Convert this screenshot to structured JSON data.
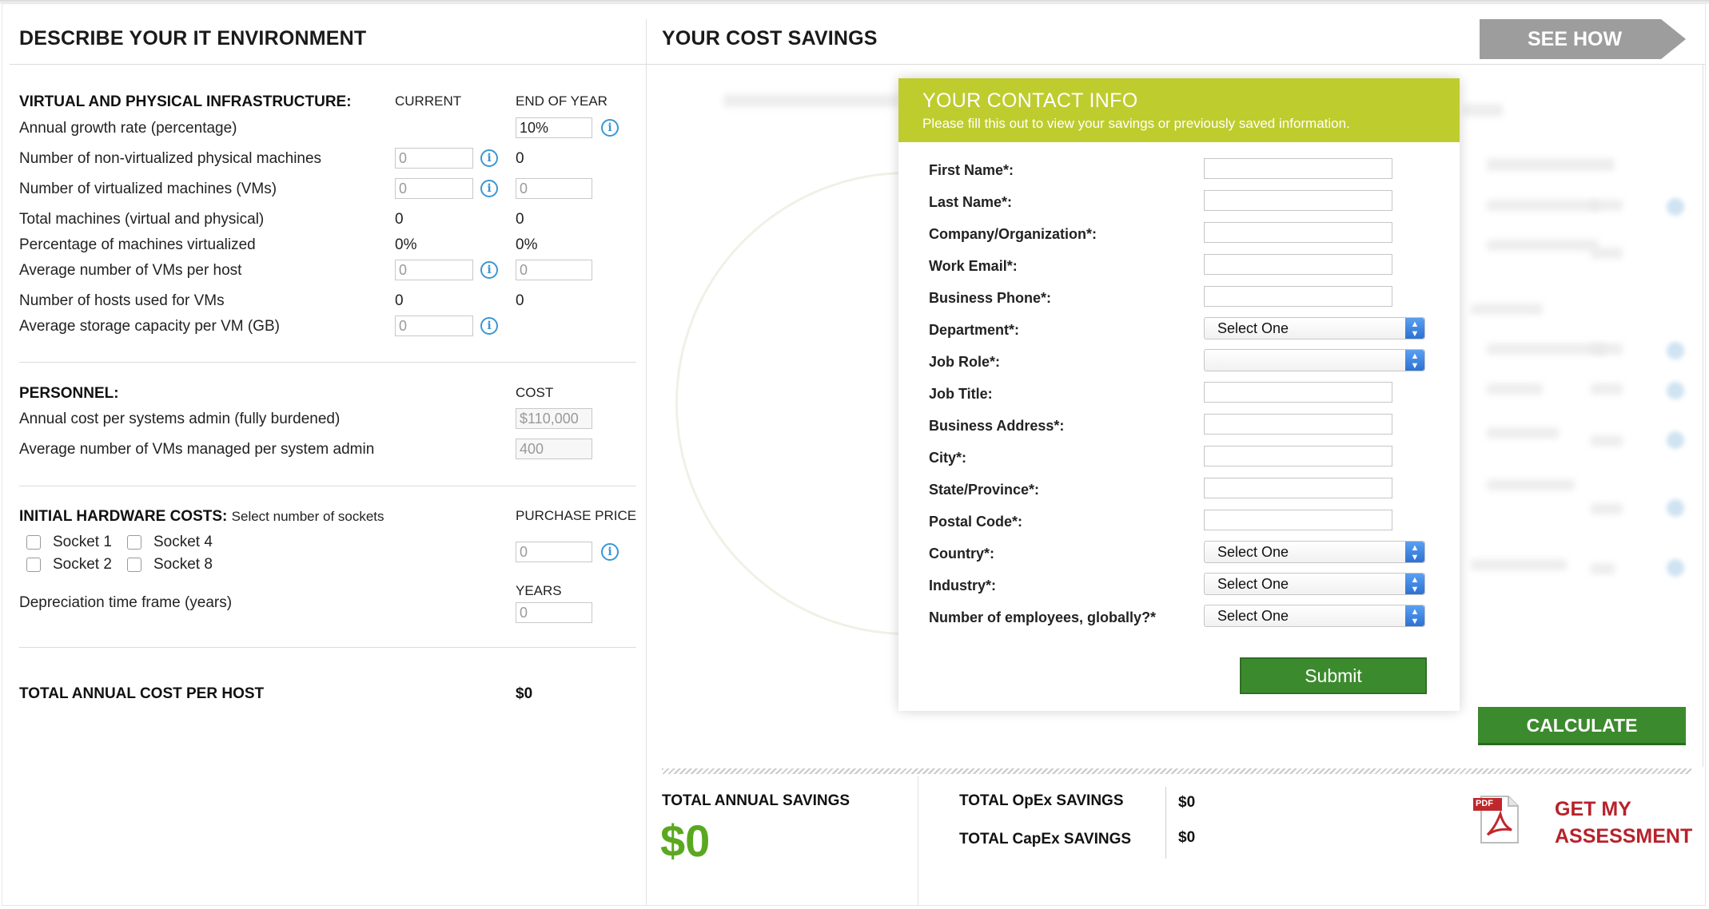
{
  "left": {
    "header": "DESCRIBE YOUR IT ENVIRONMENT",
    "infra": {
      "title": "VIRTUAL AND PHYSICAL INFRASTRUCTURE:",
      "col_current": "CURRENT",
      "col_end": "END OF YEAR",
      "growth_label": "Annual growth rate (percentage)",
      "growth_value": "10%",
      "rows": [
        {
          "label": "Number of non-virtualized physical machines",
          "current": "0",
          "end": "0"
        },
        {
          "label": "Number of virtualized machines (VMs)",
          "current": "0",
          "end": "0"
        },
        {
          "label": "Total machines (virtual and physical)",
          "current": "0",
          "end": "0"
        },
        {
          "label": "Percentage of machines virtualized",
          "current": "0%",
          "end": "0%"
        },
        {
          "label": "Average number of VMs per host",
          "current": "0",
          "end": "0"
        },
        {
          "label": "Number of hosts used for VMs",
          "current": "0",
          "end": "0"
        },
        {
          "label": "Average storage capacity per VM (GB)",
          "current": "0"
        }
      ]
    },
    "personnel": {
      "title": "PERSONNEL:",
      "col_cost": "COST",
      "rows": [
        {
          "label": "Annual cost per systems admin (fully burdened)",
          "value": "$110,000"
        },
        {
          "label": "Average number of VMs managed per system admin",
          "value": "400"
        }
      ]
    },
    "hardware": {
      "title": "INITIAL HARDWARE COSTS:",
      "subtitle": "Select number of sockets",
      "col_price": "PURCHASE PRICE",
      "price_value": "0",
      "sockets": [
        "Socket 1",
        "Socket 4",
        "Socket 2",
        "Socket 8"
      ],
      "depreciation_label": "Depreciation time frame (years)",
      "col_years": "YEARS",
      "years_value": "0"
    },
    "total": {
      "label": "TOTAL ANNUAL COST PER HOST",
      "value": "$0"
    }
  },
  "right": {
    "header": "YOUR COST SAVINGS",
    "see_how": "SEE HOW",
    "calculate": "CALCULATE",
    "total_annual_savings_label": "TOTAL ANNUAL SAVINGS",
    "total_annual_savings_value": "$0",
    "opex_label": "TOTAL OpEx SAVINGS",
    "opex_value": "$0",
    "capex_label": "TOTAL CapEx SAVINGS",
    "capex_value": "$0",
    "get_assessment_line1": "GET MY",
    "get_assessment_line2": "ASSESSMENT",
    "pdf_badge": "PDF"
  },
  "modal": {
    "title": "YOUR CONTACT INFO",
    "subtitle": "Please fill this out to view your savings or previously saved information.",
    "fields": [
      {
        "label": "First Name*:"
      },
      {
        "label": "Last Name*:"
      },
      {
        "label": "Company/Organization*:"
      },
      {
        "label": "Work Email*:"
      },
      {
        "label": "Business Phone*:"
      },
      {
        "label": "Department*:",
        "select": "Select One"
      },
      {
        "label": "Job Role*:",
        "select": ""
      },
      {
        "label": "Job Title:"
      },
      {
        "label": "Business Address*:"
      },
      {
        "label": "City*:"
      },
      {
        "label": "State/Province*:"
      },
      {
        "label": "Postal Code*:"
      },
      {
        "label": "Country*:",
        "select": "Select One"
      },
      {
        "label": "Industry*:",
        "select": "Select One"
      },
      {
        "label": "Number of employees, globally?*",
        "select": "Select One"
      }
    ],
    "submit": "Submit"
  },
  "colors": {
    "modal_header": "#bfcc2e",
    "primary_button": "#3c8a2e",
    "savings_green": "#5aa820",
    "assessment_red": "#b8222b",
    "info_blue": "#3a97d4"
  }
}
